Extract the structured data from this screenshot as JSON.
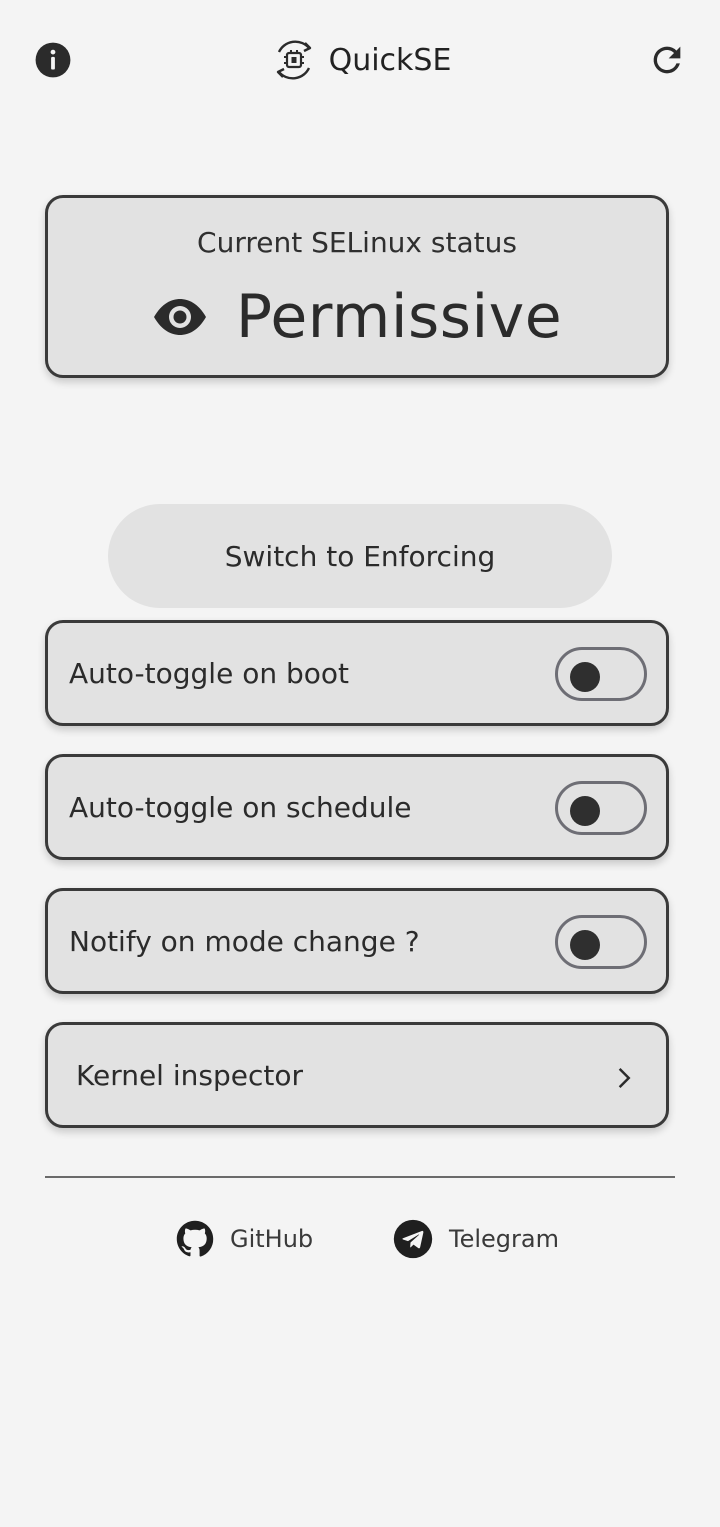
{
  "app": {
    "title": "QuickSE"
  },
  "header": {
    "info_icon": "info-icon",
    "refresh_icon": "refresh-icon",
    "logo_icon": "android-sync-logo-icon"
  },
  "status": {
    "label": "Current SELinux status",
    "value": "Permissive",
    "icon": "eye-icon"
  },
  "switch_button": {
    "label": "Switch to Enforcing"
  },
  "options": [
    {
      "label": "Auto-toggle on boot",
      "enabled": false
    },
    {
      "label": "Auto-toggle on schedule",
      "enabled": false
    },
    {
      "label": "Notify on mode change ?",
      "enabled": false
    }
  ],
  "kernel": {
    "label": "Kernel inspector",
    "icon": "chevron-right-icon"
  },
  "links": {
    "github": {
      "label": "GitHub",
      "icon": "github-icon"
    },
    "telegram": {
      "label": "Telegram",
      "icon": "telegram-icon"
    }
  },
  "colors": {
    "background": "#f4f4f4",
    "card": "#e2e2e2",
    "border": "#3a3a3a",
    "text": "#2b2b2b"
  }
}
